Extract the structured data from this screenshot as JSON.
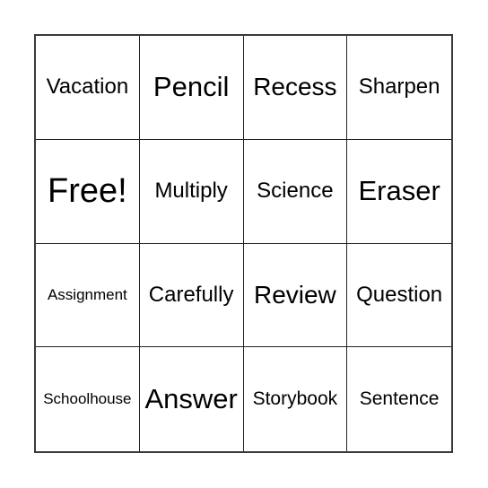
{
  "card": {
    "cells": [
      "Vacation",
      "Pencil",
      "Recess",
      "Sharpen",
      "Free!",
      "Multiply",
      "Science",
      "Eraser",
      "Assignment",
      "Carefully",
      "Review",
      "Question",
      "Schoolhouse",
      "Answer",
      "Storybook",
      "Sentence"
    ]
  }
}
